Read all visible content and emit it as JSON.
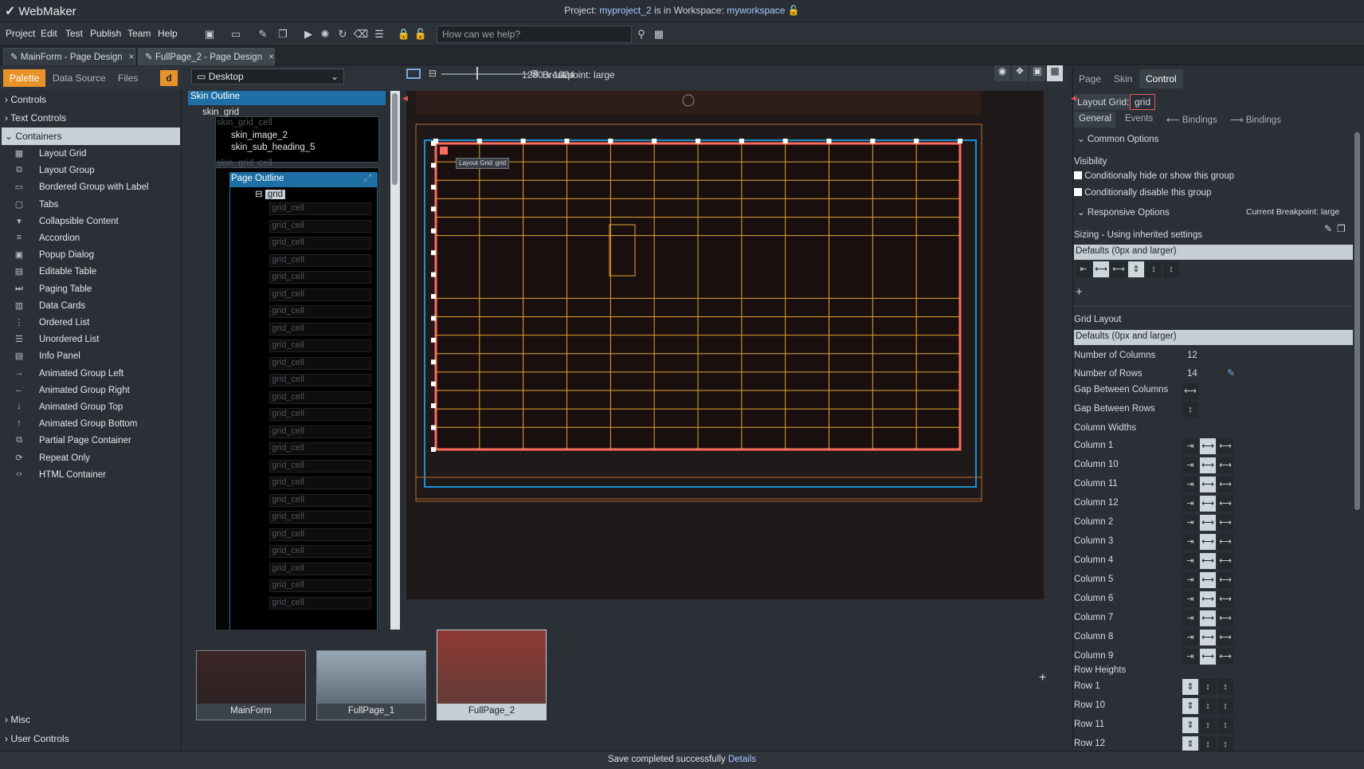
{
  "app": {
    "name": "WebMaker",
    "project_prefix": "Project:",
    "project": "myproject_2",
    "mid": "is in Workspace:",
    "workspace": "myworkspace"
  },
  "menu": [
    "Project",
    "Edit",
    "Test",
    "Publish",
    "Team",
    "Help"
  ],
  "search": {
    "placeholder": "How can we help?"
  },
  "doc_tabs": [
    {
      "label": "MainForm - Page Design"
    },
    {
      "label": "FullPage_2 - Page Design"
    }
  ],
  "palette": {
    "tabs": [
      "Palette",
      "Data Source",
      "Files"
    ],
    "sections": {
      "controls": "Controls",
      "text_controls": "Text Controls",
      "containers": "Containers",
      "misc": "Misc",
      "user_controls": "User Controls"
    },
    "items": [
      {
        "label": "Layout Grid",
        "icon": "grid-icon"
      },
      {
        "label": "Layout Group",
        "icon": "layout-group-icon"
      },
      {
        "label": "Bordered Group with Label",
        "icon": "bordered-group-icon"
      },
      {
        "label": "Tabs",
        "icon": "tabs-icon"
      },
      {
        "label": "Collapsible Content",
        "icon": "collapse-icon"
      },
      {
        "label": "Accordion",
        "icon": "accordion-icon"
      },
      {
        "label": "Popup Dialog",
        "icon": "popup-icon"
      },
      {
        "label": "Editable Table",
        "icon": "table-icon"
      },
      {
        "label": "Paging Table",
        "icon": "paging-icon"
      },
      {
        "label": "Data Cards",
        "icon": "cards-icon"
      },
      {
        "label": "Ordered List",
        "icon": "ordered-list-icon"
      },
      {
        "label": "Unordered List",
        "icon": "unordered-list-icon"
      },
      {
        "label": "Info Panel",
        "icon": "info-panel-icon"
      },
      {
        "label": "Animated Group Left",
        "icon": "arrow-right-icon"
      },
      {
        "label": "Animated Group Right",
        "icon": "arrow-left-icon"
      },
      {
        "label": "Animated Group Top",
        "icon": "arrow-down-icon"
      },
      {
        "label": "Animated Group Bottom",
        "icon": "arrow-up-icon"
      },
      {
        "label": "Partial Page Container",
        "icon": "partial-page-icon"
      },
      {
        "label": "Repeat Only",
        "icon": "repeat-icon"
      },
      {
        "label": "HTML Container",
        "icon": "code-icon"
      }
    ]
  },
  "outline": {
    "skin_outline": "Skin Outline",
    "skin_grid": "skin_grid",
    "skin_grid_cell": "skin_grid_cell",
    "skin_image": "skin_image_2",
    "skin_sub_heading": "skin_sub_heading_5",
    "page_outline": "Page Outline",
    "grid": "grid",
    "grid_cell": "grid_cell"
  },
  "toolbar": {
    "device": "Desktop",
    "size": "1280 x 1024",
    "breakpoint": "Breakpoint: large"
  },
  "canvas": {
    "tooltip": "Layout Grid: grid",
    "columns": 12,
    "rows": 14
  },
  "thumbs": [
    "MainForm",
    "FullPage_1",
    "FullPage_2"
  ],
  "right": {
    "tabs": [
      "Page",
      "Skin",
      "Control"
    ],
    "layout_grid_label": "Layout Grid:",
    "layout_grid_value": "grid",
    "subtabs": [
      "General",
      "Events",
      "Bindings",
      "Bindings"
    ],
    "common_options": "Common Options",
    "visibility": "Visibility",
    "cond_hide": "Conditionally hide or show this group",
    "cond_disable": "Conditionally disable this group",
    "responsive": "Responsive Options",
    "current_bp": "Current Breakpoint: large",
    "sizing": "Sizing",
    "sizing_note": "Using inherited settings",
    "defaults": "Defaults (0px and larger)",
    "grid_layout": "Grid Layout",
    "num_cols_label": "Number of Columns",
    "num_cols": "12",
    "num_rows_label": "Number of Rows",
    "num_rows": "14",
    "gap_cols": "Gap Between Columns",
    "gap_rows": "Gap Between Rows",
    "col_widths": "Column Widths",
    "columns": [
      "Column 1",
      "Column 10",
      "Column 11",
      "Column 12",
      "Column 2",
      "Column 3",
      "Column 4",
      "Column 5",
      "Column 6",
      "Column 7",
      "Column 8",
      "Column 9"
    ],
    "row_heights": "Row Heights",
    "rows": [
      "Row 1",
      "Row 10",
      "Row 11",
      "Row 12"
    ]
  },
  "status": {
    "text": "Save completed successfully",
    "link": "Details"
  }
}
